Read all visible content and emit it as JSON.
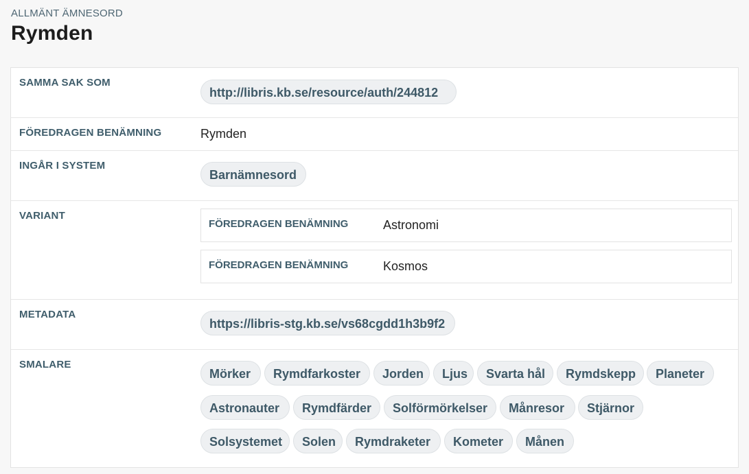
{
  "header": {
    "type_label": "ALLMÄNT ÄMNESORD",
    "title": "Rymden"
  },
  "rows": {
    "same_as": {
      "label": "SAMMA SAK SOM",
      "link": "http://libris.kb.se/resource/auth/244812"
    },
    "pref_label": {
      "label": "FÖREDRAGEN BENÄMNING",
      "value": "Rymden"
    },
    "in_scheme": {
      "label": "INGÅR I SYSTEM",
      "value": "Barnämnesord"
    },
    "variant": {
      "label": "VARIANT",
      "items": [
        {
          "label": "FÖREDRAGEN BENÄMNING",
          "value": "Astronomi"
        },
        {
          "label": "FÖREDRAGEN BENÄMNING",
          "value": "Kosmos"
        }
      ]
    },
    "metadata": {
      "label": "METADATA",
      "link": "https://libris-stg.kb.se/vs68cgdd1h3b9f2"
    },
    "narrower": {
      "label": "SMALARE",
      "items": [
        "Mörker",
        "Rymdfarkoster",
        "Jorden",
        "Ljus",
        "Svarta hål",
        "Rymdskepp",
        "Planeter",
        "Astronauter",
        "Rymdfärder",
        "Solförmörkelser",
        "Månresor",
        "Stjärnor",
        "Solsystemet",
        "Solen",
        "Rymdraketer",
        "Kometer",
        "Månen"
      ]
    }
  }
}
